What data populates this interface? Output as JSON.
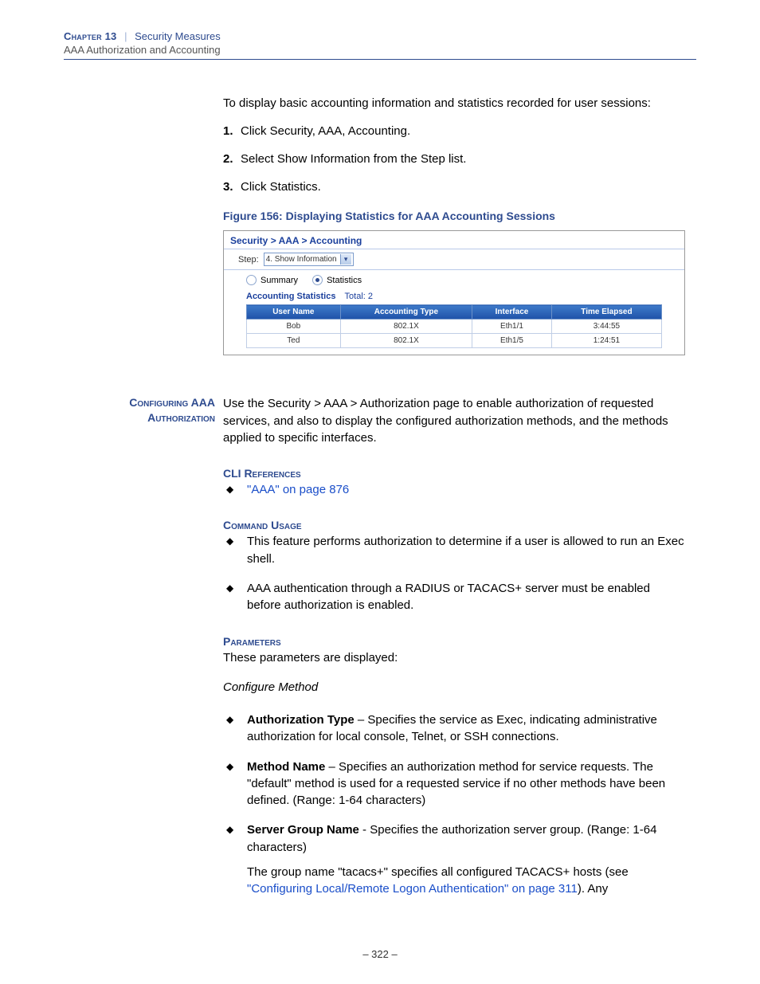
{
  "header": {
    "chapter_label": "Chapter 13",
    "divider": "|",
    "section_title": "Security Measures",
    "subtitle": "AAA Authorization and Accounting"
  },
  "intro": "To display basic accounting information and statistics recorded for user sessions:",
  "steps": [
    {
      "num": "1.",
      "text": "Click Security, AAA, Accounting."
    },
    {
      "num": "2.",
      "text": "Select Show Information from the Step list."
    },
    {
      "num": "3.",
      "text": "Click Statistics."
    }
  ],
  "figure_caption": "Figure 156:  Displaying Statistics for AAA Accounting Sessions",
  "panel": {
    "breadcrumb": "Security > AAA > Accounting",
    "step_label": "Step:",
    "step_value": "4. Show Information",
    "radio_summary": "Summary",
    "radio_statistics": "Statistics",
    "stats_label": "Accounting Statistics",
    "total_label": "Total: 2",
    "columns": [
      "User Name",
      "Accounting Type",
      "Interface",
      "Time Elapsed"
    ],
    "rows": [
      [
        "Bob",
        "802.1X",
        "Eth1/1",
        "3:44:55"
      ],
      [
        "Ted",
        "802.1X",
        "Eth1/5",
        "1:24:51"
      ]
    ]
  },
  "section": {
    "margin_head_l1": "Configuring AAA",
    "margin_head_l2": "Authorization",
    "body": "Use the Security > AAA > Authorization page to enable authorization of requested services, and also to display the configured authorization methods, and the methods applied to specific interfaces."
  },
  "cli_ref_heading": "CLI References",
  "cli_ref_link": "\"AAA\" on page 876",
  "cmd_usage_heading": "Command Usage",
  "cmd_usage_items": [
    "This feature performs authorization to determine if a user is allowed to run an Exec shell.",
    "AAA authentication through a RADIUS or TACACS+ server must be enabled before authorization is enabled."
  ],
  "params_heading": "Parameters",
  "params_intro": "These parameters are displayed:",
  "params_sub": "Configure Method",
  "param_items": {
    "auth_type": {
      "label": "Authorization Type",
      "desc": " – Specifies the service as Exec, indicating administrative authorization for local console, Telnet, or SSH connections."
    },
    "method_name": {
      "label": "Method Name",
      "desc": " – Specifies an authorization method for service requests. The \"default\" method is used for a requested service if no other methods have been defined. (Range: 1-64 characters)"
    },
    "server_group": {
      "label": "Server Group Name",
      "desc": " - Specifies the authorization server group. (Range: 1-64 characters)",
      "note_pre": "The group name \"tacacs+\" specifies all configured TACACS+ hosts (see ",
      "note_link": "\"Configuring Local/Remote Logon Authentication\" on page 311",
      "note_post": "). Any"
    }
  },
  "page_number": "–  322  –",
  "chart_data": {
    "type": "table",
    "title": "Accounting Statistics",
    "columns": [
      "User Name",
      "Accounting Type",
      "Interface",
      "Time Elapsed"
    ],
    "rows": [
      [
        "Bob",
        "802.1X",
        "Eth1/1",
        "3:44:55"
      ],
      [
        "Ted",
        "802.1X",
        "Eth1/5",
        "1:24:51"
      ]
    ]
  }
}
